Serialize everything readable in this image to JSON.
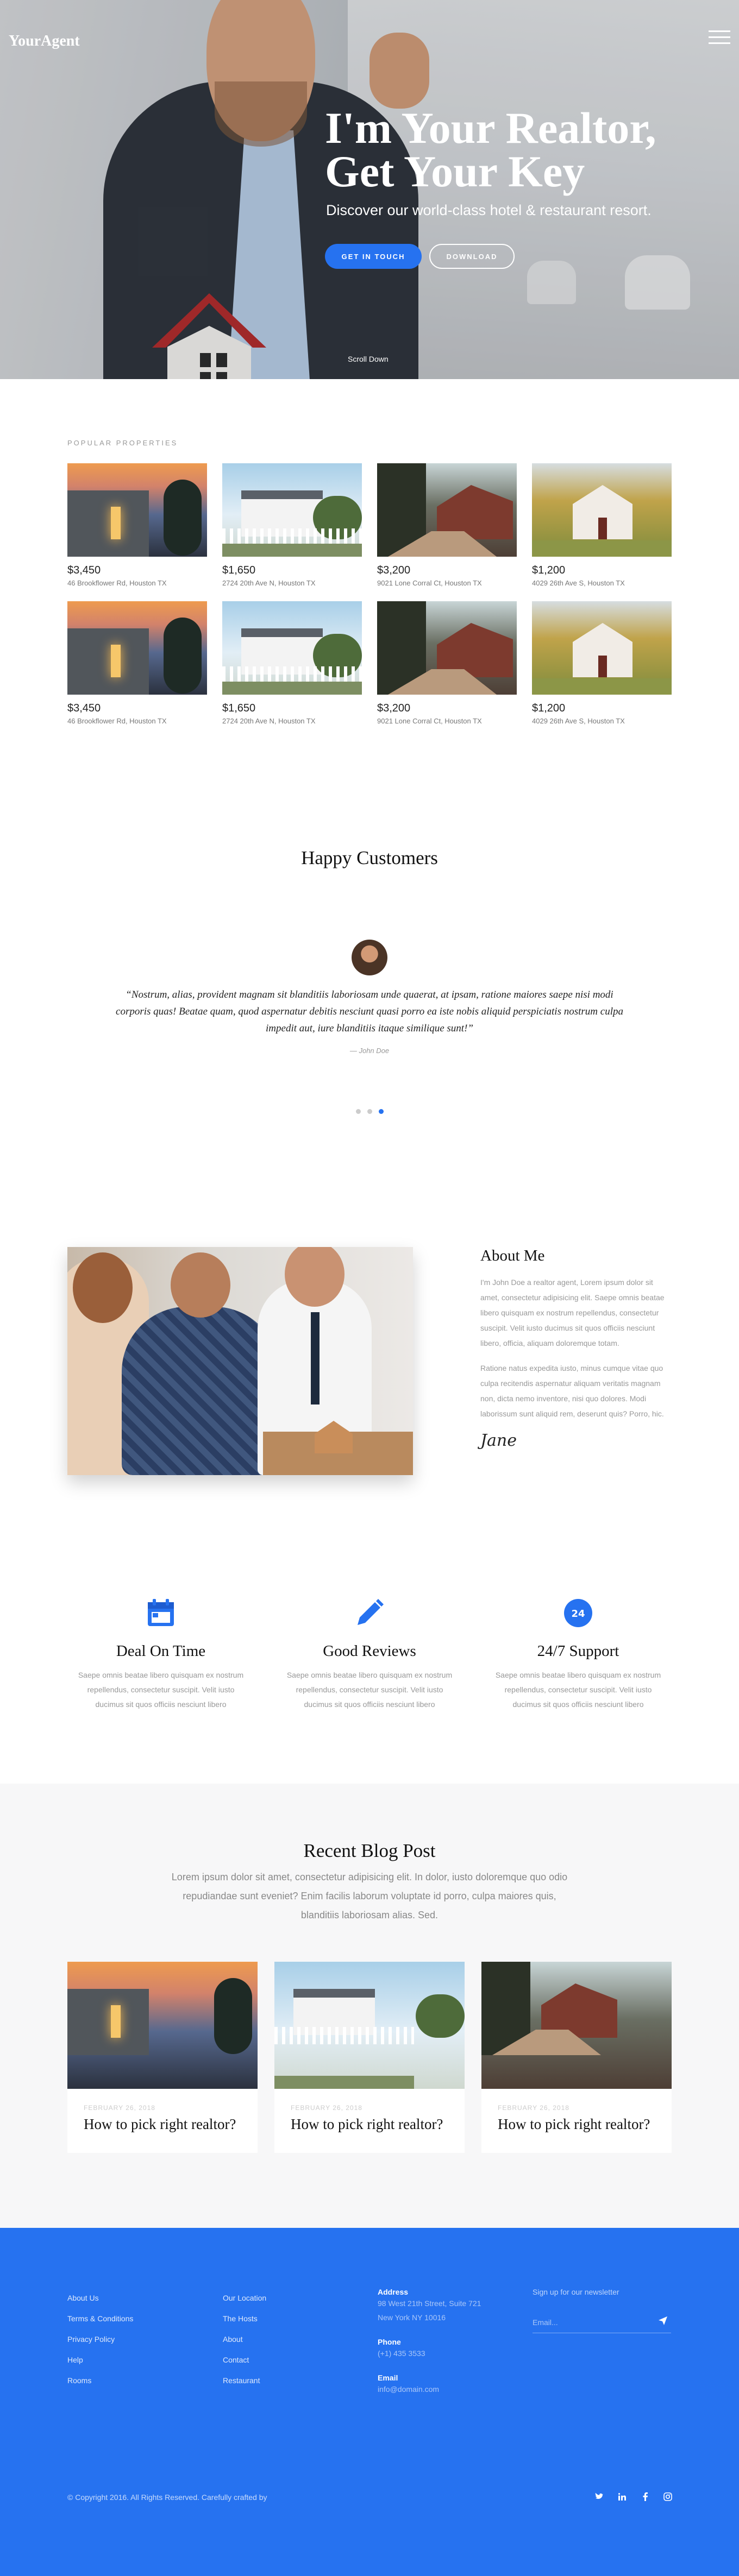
{
  "brand": {
    "logo": "YourAgent",
    "accent": "#2672f0"
  },
  "hero": {
    "title_line1": "I'm Your Realtor,",
    "title_line2": "Get Your Key",
    "subtitle": "Discover our world-class hotel & restaurant resort.",
    "primary_btn": "GET IN TOUCH",
    "secondary_btn": "DOWNLOAD",
    "scroll": "Scroll Down"
  },
  "properties": {
    "label": "POPULAR PROPERTIES",
    "items": [
      {
        "price": "$3,450",
        "address": "46 Brookflower Rd, Houston TX",
        "img": "house-evening"
      },
      {
        "price": "$1,650",
        "address": "2724 20th Ave N, Houston TX",
        "img": "house-white-fence"
      },
      {
        "price": "$3,200",
        "address": "9021 Lone Corral Ct, Houston TX",
        "img": "house-red-road"
      },
      {
        "price": "$1,200",
        "address": "4029 26th Ave S, Houston TX",
        "img": "house-autumn"
      },
      {
        "price": "$3,450",
        "address": "46 Brookflower Rd, Houston TX",
        "img": "house-evening"
      },
      {
        "price": "$1,650",
        "address": "2724 20th Ave N, Houston TX",
        "img": "house-white-fence"
      },
      {
        "price": "$3,200",
        "address": "9021 Lone Corral Ct, Houston TX",
        "img": "house-red-road"
      },
      {
        "price": "$1,200",
        "address": "4029 26th Ave S, Houston TX",
        "img": "house-autumn"
      }
    ]
  },
  "testimonials": {
    "title": "Happy Customers",
    "quote": "“Nostrum, alias, provident magnam sit blanditiis laboriosam unde quaerat, at ipsam, ratione maiores saepe nisi modi corporis quas! Beatae quam, quod aspernatur debitis nesciunt quasi porro ea iste nobis aliquid perspiciatis nostrum culpa impedit aut, iure blanditiis itaque similique sunt!”",
    "author": "— John Doe",
    "active_dot": 3
  },
  "about": {
    "title": "About Me",
    "p1": "I'm John Doe a realtor agent, Lorem ipsum dolor sit amet, consectetur adipisicing elit. Saepe omnis beatae libero quisquam ex nostrum repellendus, consectetur suscipit. Velit iusto ducimus sit quos officiis nesciunt libero, officia, aliquam doloremque totam.",
    "p2": "Ratione natus expedita iusto, minus cumque vitae quo culpa recitendis aspernatur aliquam veritatis magnam non, dicta nemo inventore, nisi quo dolores. Modi laborissum sunt aliquid rem, deserunt quis? Porro, hic.",
    "signature": "Jane"
  },
  "features": [
    {
      "icon": "calendar-icon",
      "title": "Deal On Time",
      "text": "Saepe omnis beatae libero quisquam ex nostrum repellendus, consectetur suscipit. Velit iusto ducimus sit quos officiis nesciunt libero"
    },
    {
      "icon": "pencil-icon",
      "title": "Good Reviews",
      "text": "Saepe omnis beatae libero quisquam ex nostrum repellendus, consectetur suscipit. Velit iusto ducimus sit quos officiis nesciunt libero"
    },
    {
      "icon": "support-icon",
      "title": "24/7 Support",
      "text": "Saepe omnis beatae libero quisquam ex nostrum repellendus, consectetur suscipit. Velit iusto ducimus sit quos officiis nesciunt libero"
    }
  ],
  "blog": {
    "title": "Recent Blog Post",
    "intro": "Lorem ipsum dolor sit amet, consectetur adipisicing elit. In dolor, iusto doloremque quo odio repudiandae sunt eveniet? Enim facilis laborum voluptate id porro, culpa maiores quis, blanditiis laboriosam alias. Sed.",
    "posts": [
      {
        "date": "FEBRUARY 26, 2018",
        "title": "How to pick right realtor?",
        "img": "house-evening"
      },
      {
        "date": "FEBRUARY 26, 2018",
        "title": "How to pick right realtor?",
        "img": "house-white-fence"
      },
      {
        "date": "FEBRUARY 26, 2018",
        "title": "How to pick right realtor?",
        "img": "house-red-road"
      }
    ]
  },
  "footer": {
    "col1": [
      "About Us",
      "Terms & Conditions",
      "Privacy Policy",
      "Help",
      "Rooms"
    ],
    "col2": [
      "Our Location",
      "The Hosts",
      "About",
      "Contact",
      "Restaurant"
    ],
    "address_label": "Address",
    "address": "98 West 21th Street, Suite 721 New York NY 10016",
    "phone_label": "Phone",
    "phone": "(+1) 435 3533",
    "email_label": "Email",
    "email": "info@domain.com",
    "newsletter_label": "Sign up for our newsletter",
    "newsletter_placeholder": "Email...",
    "copyright": "© Copyright 2016. All Rights Reserved. Carefully crafted by",
    "socials": [
      "twitter-icon",
      "linkedin-icon",
      "facebook-icon",
      "instagram-icon"
    ]
  }
}
